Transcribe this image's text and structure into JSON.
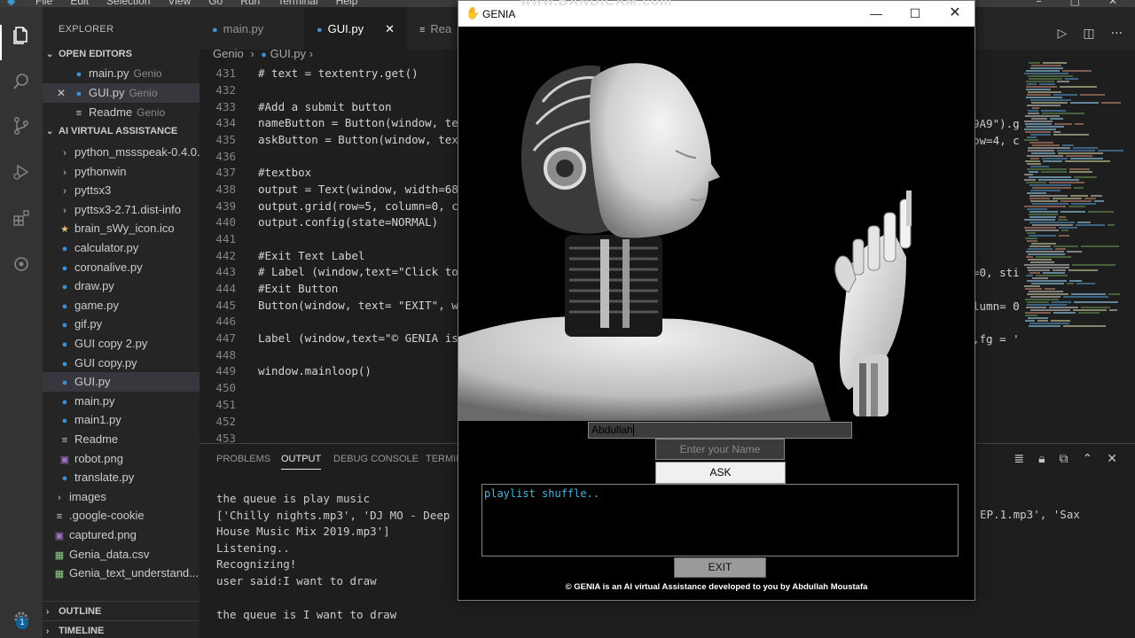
{
  "titlebar": {
    "menu": [
      "File",
      "Edit",
      "Selection",
      "View",
      "Go",
      "Run",
      "Terminal",
      "Help"
    ]
  },
  "activity": {
    "icons": [
      "explorer-icon",
      "search-icon",
      "source-control-icon",
      "run-debug-icon",
      "extensions-icon",
      "remote-icon",
      "settings-gear-icon"
    ],
    "badge": "1"
  },
  "sidebar": {
    "title": "EXPLORER",
    "open_editors_label": "OPEN EDITORS",
    "open_editors": [
      {
        "name": "main.py",
        "desc": "Genio"
      },
      {
        "name": "GUI.py",
        "desc": "Genio"
      },
      {
        "name": "Readme",
        "desc": "Genio"
      }
    ],
    "project_label": "AI VIRTUAL ASSISTANCE",
    "files": [
      "python_mssspeak-0.4.0...",
      "pythonwin",
      "pyttsx3",
      "pyttsx3-2.71.dist-info",
      "brain_sWy_icon.ico",
      "calculator.py",
      "coronalive.py",
      "draw.py",
      "game.py",
      "gif.py",
      "GUI copy 2.py",
      "GUI copy.py",
      "GUI.py",
      "main.py",
      "main1.py",
      "Readme",
      "robot.png",
      "translate.py",
      "images",
      ".google-cookie",
      "captured.png",
      "Genia_data.csv",
      "Genia_text_understand..."
    ],
    "outline_label": "OUTLINE",
    "timeline_label": "TIMELINE"
  },
  "tabs": [
    {
      "name": "main.py"
    },
    {
      "name": "GUI.py"
    },
    {
      "name": "Rea"
    }
  ],
  "breadcrumb": {
    "folder": "Genio",
    "file": "GUI.py"
  },
  "editor": {
    "lines": [
      {
        "n": "431",
        "code": "# text = textentry.get()"
      },
      {
        "n": "432",
        "code": ""
      },
      {
        "n": "433",
        "code": "#Add a submit button"
      },
      {
        "n": "434",
        "code": "nameButton = Button(window, te"
      },
      {
        "n": "435",
        "code": "askButton = Button(window, tex"
      },
      {
        "n": "436",
        "code": ""
      },
      {
        "n": "437",
        "code": "#textbox"
      },
      {
        "n": "438",
        "code": "output = Text(window, width=68"
      },
      {
        "n": "439",
        "code": "output.grid(row=5, column=0, c"
      },
      {
        "n": "440",
        "code": "output.config(state=NORMAL)"
      },
      {
        "n": "441",
        "code": ""
      },
      {
        "n": "442",
        "code": "#Exit Text Label"
      },
      {
        "n": "443",
        "code": "# Label (window,text=\"Click to"
      },
      {
        "n": "444",
        "code": "#Exit Button"
      },
      {
        "n": "445",
        "code": "Button(window, text= \"EXIT\", w"
      },
      {
        "n": "446",
        "code": ""
      },
      {
        "n": "447",
        "code": "Label (window,text=\"© GENIA is"
      },
      {
        "n": "448",
        "code": ""
      },
      {
        "n": "449",
        "code": "window.mainloop()"
      },
      {
        "n": "450",
        "code": ""
      },
      {
        "n": "451",
        "code": ""
      },
      {
        "n": "452",
        "code": ""
      },
      {
        "n": "453",
        "code": ""
      }
    ],
    "right_fragments": {
      "l434": "9A9\").g",
      "l435": "ow=4, c",
      "l443": "=0, sti",
      "l445": "lumn= 0",
      "l447": ",fg = '"
    }
  },
  "panel": {
    "tabs": [
      "PROBLEMS",
      "OUTPUT",
      "DEBUG CONSOLE",
      "TERMIN"
    ],
    "lines": [
      "the queue is play music",
      "['Chilly nights.mp3', 'DJ MO - Deep",
      "House Music Mix 2019.mp3']",
      "Listening..",
      "Recognizing!",
      "user said:I want to draw",
      "",
      "the queue is I want to draw"
    ],
    "right_fragment": "EP.1.mp3', 'Sax"
  },
  "genia": {
    "title": "GENIA",
    "watermark": "www.BANDICAM.com",
    "image_alt": "robot",
    "entry_value": "Abdullah",
    "name_button": "Enter your Name",
    "ask_button": "ASK",
    "output_text": "playlist shuffle..",
    "exit_button": "EXIT",
    "footer": "© GENIA is an AI virtual Assistance developed to you by Abdullah Moustafa"
  }
}
